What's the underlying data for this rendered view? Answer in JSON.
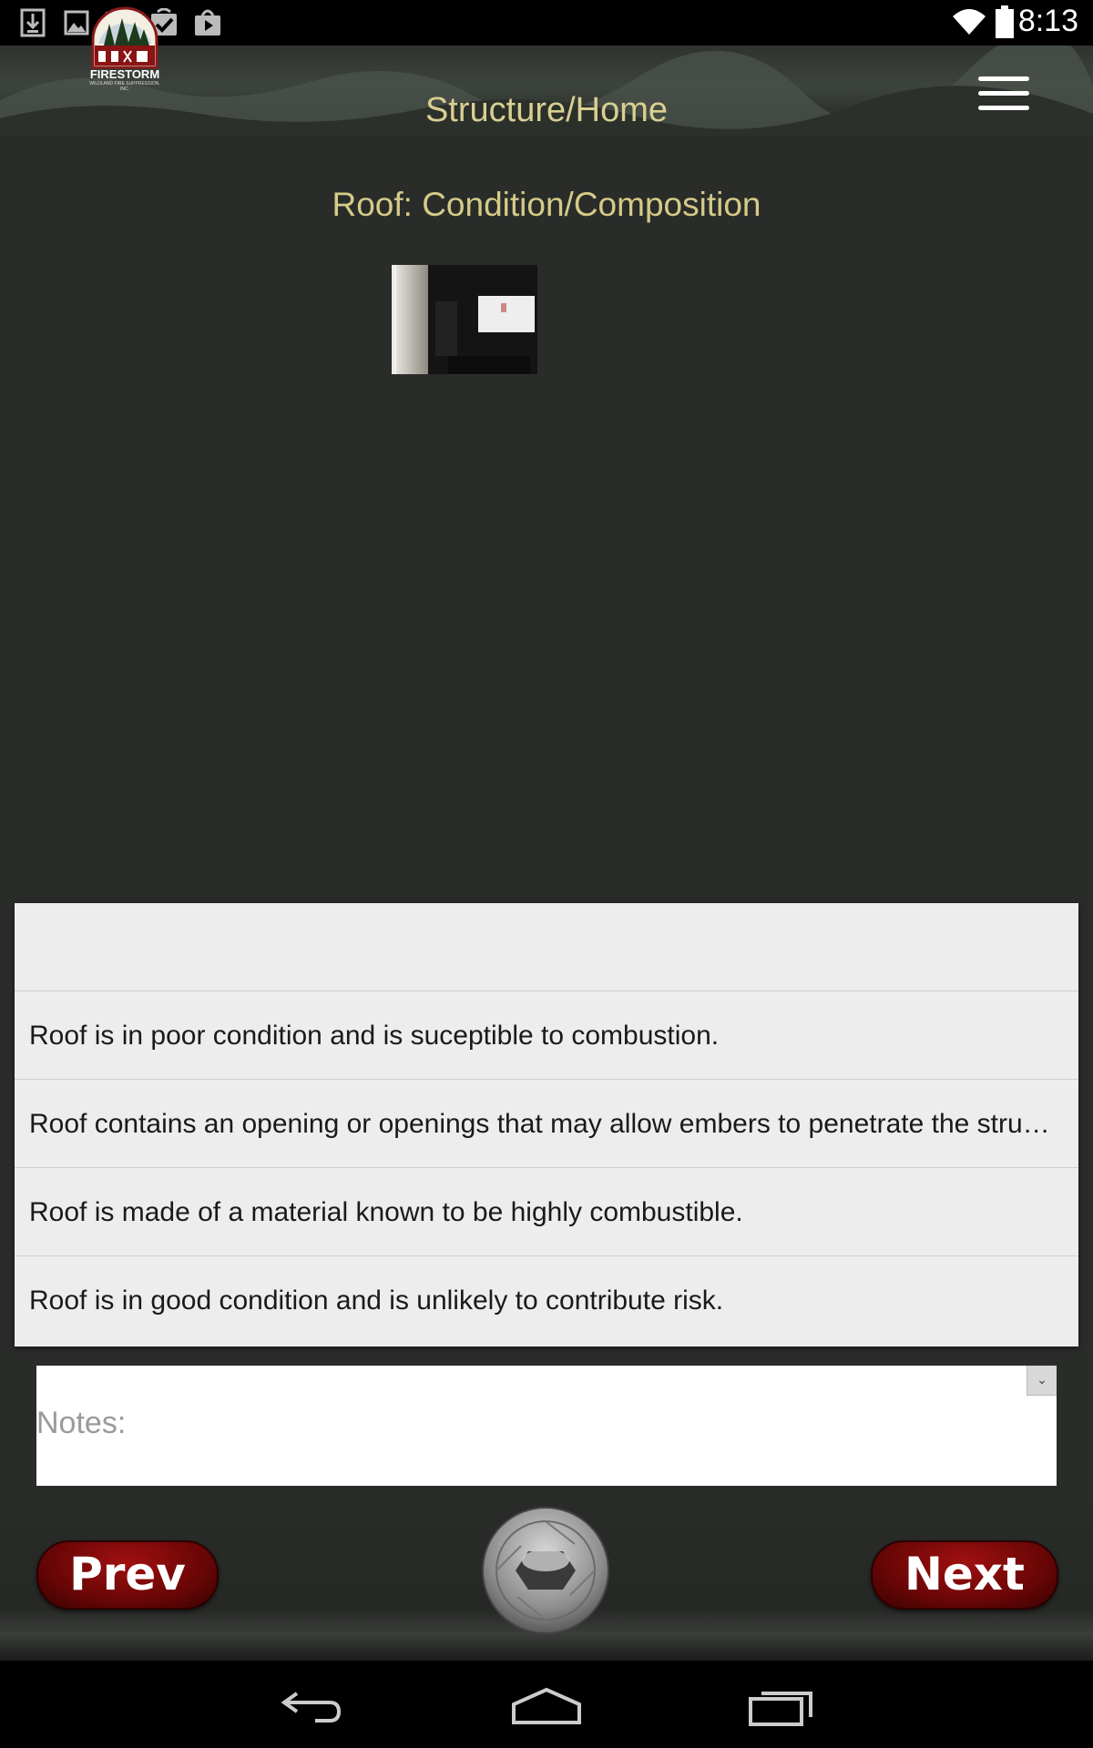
{
  "status_bar": {
    "time": "8:13",
    "left_icons": [
      "download-icon",
      "image-icon",
      "gmail-icon",
      "task-check-icon",
      "play-store-icon"
    ],
    "right_icons": [
      "wifi-icon",
      "battery-icon"
    ]
  },
  "header": {
    "title": "Structure/Home",
    "logo_text": "FIRESTORM",
    "logo_subtext": "WILDLAND FIRE SUPPRESSION, INC.",
    "menu_icon": "hamburger-menu-icon"
  },
  "main": {
    "section_title": "Roof: Condition/Composition"
  },
  "options": [
    "",
    "Roof is in poor condition and is suceptible to combustion.",
    "Roof contains an opening or openings that may allow embers to penetrate the structure.",
    "Roof is made of a material known to be highly combustible.",
    "Roof is in good condition and is unlikely to contribute risk."
  ],
  "notes": {
    "placeholder": "Notes:"
  },
  "footer": {
    "prev_label": "Prev",
    "next_label": "Next",
    "camera_icon": "camera-shutter-icon"
  },
  "nav_bar": {
    "icons": [
      "back-icon",
      "home-icon",
      "recents-icon"
    ]
  },
  "colors": {
    "background": "#2a2c2a",
    "title_gold": "#d8cf91",
    "button_red": "#8b0a0a"
  }
}
